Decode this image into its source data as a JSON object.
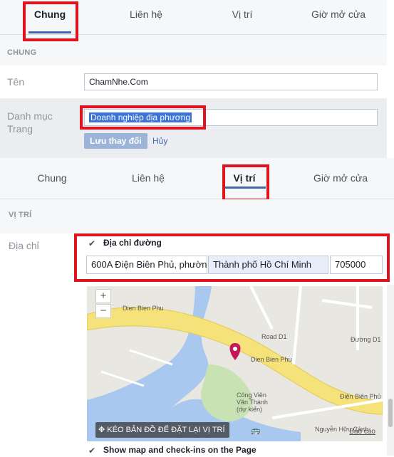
{
  "panel1": {
    "tabs": [
      {
        "label": "Chung"
      },
      {
        "label": "Liên hệ"
      },
      {
        "label": "Vị trí"
      },
      {
        "label": "Giờ mở cửa"
      }
    ],
    "section_title": "CHUNG",
    "name_label": "Tên",
    "name_value": "ChamNhe.Com",
    "category_label": "Danh mục Trang",
    "category_value": "Doanh nghiệp địa phương",
    "save_label": "Lưu thay đổi",
    "cancel_label": "Hủy"
  },
  "panel2": {
    "tabs": [
      {
        "label": "Chung"
      },
      {
        "label": "Liên hệ"
      },
      {
        "label": "Vị trí"
      },
      {
        "label": "Giờ mở cửa"
      }
    ],
    "section_title": "VỊ TRÍ",
    "address_label": "Địa chỉ",
    "street_checkbox_label": "Địa chỉ đường",
    "street_value": "600A Điện Biên Phủ, phường",
    "city_value": "Thành phố Hồ Chí Minh",
    "zip_value": "705000",
    "map": {
      "zoom_in": "+",
      "zoom_out": "−",
      "drag_hint": "KÉO BẢN ĐỒ ĐỂ ĐẶT LẠI VỊ TRÍ",
      "report": "Báo cáo",
      "labels": {
        "street1": "Dien Bien Phu",
        "street2": "Dien Bien Phu",
        "street3": "Điện Biên Phủ",
        "road_d1": "Road D1",
        "duong_d1": "Đường D1",
        "park": "Công Viên Văn Thánh (dự kiến)",
        "street4": "Nguyễn Hữu Cảnh"
      }
    },
    "show_map_label": "Show map and check-ins on the Page"
  }
}
